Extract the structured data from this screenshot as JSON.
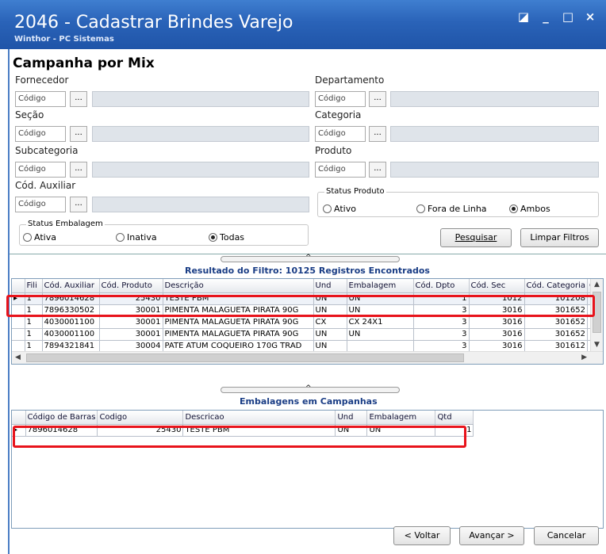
{
  "window": {
    "title": "2046 - Cadastrar Brindes Varejo",
    "subtitle": "Winthor - PC Sistemas",
    "controls": [
      "◪",
      "_",
      "□",
      "×"
    ]
  },
  "section_title": "Campanha por Mix",
  "filters": {
    "code_placeholder": "Código",
    "browse_label": "...",
    "fornecedor": "Fornecedor",
    "departamento": "Departamento",
    "secao": "Seção",
    "categoria": "Categoria",
    "subcategoria": "Subcategoria",
    "produto": "Produto",
    "cod_auxiliar": "Cód. Auxiliar"
  },
  "status_produto": {
    "caption": "Status Produto",
    "options": [
      "Ativo",
      "Fora de Linha",
      "Ambos"
    ],
    "selected": "Ambos"
  },
  "status_embalagem": {
    "caption": "Status Embalagem",
    "options": [
      "Ativa",
      "Inativa",
      "Todas"
    ],
    "selected": "Todas"
  },
  "buttons": {
    "pesquisar": "Pesquisar",
    "limpar": "Limpar Filtros",
    "voltar": "< Voltar",
    "avancar": "Avançar >",
    "cancelar": "Cancelar"
  },
  "result_title": "Resultado do Filtro: 10125 Registros Encontrados",
  "result_grid": {
    "columns": [
      "Fili",
      "Cód. Auxiliar",
      "Cód. Produto",
      "Descrição",
      "Und",
      "Embalagem",
      "Cód. Dpto",
      "Cód. Sec",
      "Cód. Categoria",
      "C"
    ],
    "rows": [
      [
        "1",
        "7896014628",
        "25430",
        "TESTE PBM",
        "UN",
        "UN",
        "1",
        "1012",
        "101208"
      ],
      [
        "1",
        "7896330502",
        "30001",
        "PIMENTA MALAGUETA PIRATA 90G",
        "UN",
        "UN",
        "3",
        "3016",
        "301652"
      ],
      [
        "1",
        "4030001100",
        "30001",
        "PIMENTA MALAGUETA PIRATA 90G",
        "CX",
        "CX 24X1",
        "3",
        "3016",
        "301652"
      ],
      [
        "1",
        "4030001100",
        "30001",
        "PIMENTA MALAGUETA PIRATA 90G",
        "UN",
        "UN",
        "3",
        "3016",
        "301652"
      ],
      [
        "1",
        "7894321841",
        "30004",
        "PATE ATUM COQUEIRO 170G TRAD",
        "UN",
        "",
        "3",
        "3016",
        "301612"
      ]
    ]
  },
  "campaign_title": "Embalagens em Campanhas",
  "campaign_grid": {
    "columns": [
      "Código de Barras",
      "Codigo",
      "Descricao",
      "Und",
      "Embalagem",
      "Qtd"
    ],
    "rows": [
      [
        "7896014628",
        "25430",
        "TESTE PBM",
        "UN",
        "UN",
        "1"
      ]
    ]
  },
  "colors": {
    "highlight": "#e8131b",
    "titlebar": "#2a63b8",
    "section_text": "#1a3d85"
  }
}
